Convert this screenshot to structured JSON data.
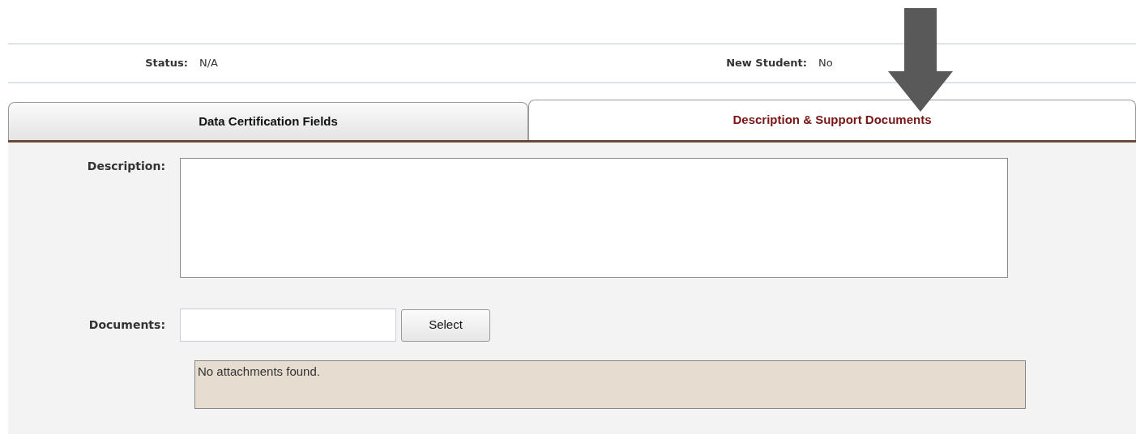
{
  "header_fields": [
    {
      "label": "Status:",
      "value": "N/A"
    },
    {
      "label": "New Student:",
      "value": "No"
    }
  ],
  "tabs": [
    {
      "label": "Data Certification Fields",
      "selected": false
    },
    {
      "label": "Description & Support Documents",
      "selected": true
    }
  ],
  "description": {
    "label": "Description:"
  },
  "documents": {
    "label": "Documents:",
    "button": "Select",
    "attachments_message": "No attachments found."
  }
}
